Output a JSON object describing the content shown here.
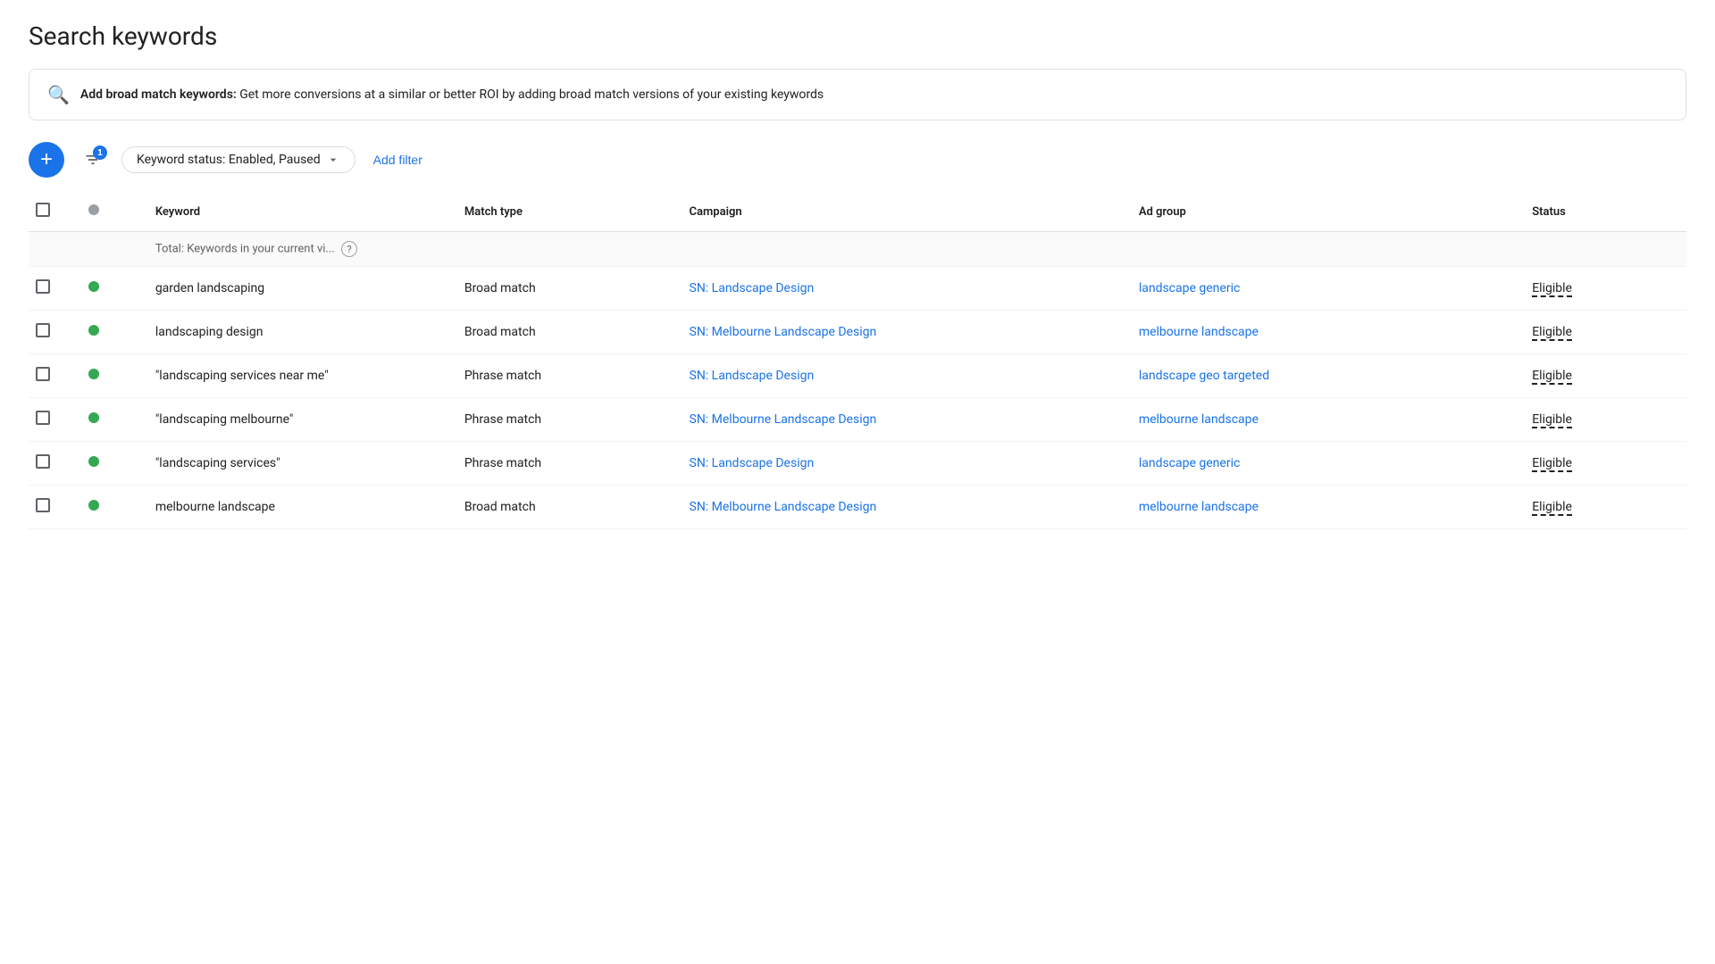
{
  "page": {
    "title": "Search keywords"
  },
  "banner": {
    "icon": "🔍",
    "label": "Add broad match keywords:",
    "description": "Get more conversions at a similar or better ROI by adding broad match versions of your existing keywords"
  },
  "toolbar": {
    "add_label": "+",
    "filter_badge": "1",
    "status_filter_label": "Keyword status: Enabled, Paused",
    "add_filter_label": "Add filter"
  },
  "table": {
    "columns": {
      "keyword": "Keyword",
      "match_type": "Match type",
      "campaign": "Campaign",
      "ad_group": "Ad group",
      "status": "Status"
    },
    "total_row": {
      "label": "Total: Keywords in your current vi..."
    },
    "rows": [
      {
        "id": 1,
        "status_dot": "green",
        "keyword": "garden landscaping",
        "match_type": "Broad match",
        "campaign": "SN: Landscape Design",
        "ad_group": "landscape generic",
        "status": "Eligible"
      },
      {
        "id": 2,
        "status_dot": "green",
        "keyword": "landscaping design",
        "match_type": "Broad match",
        "campaign": "SN: Melbourne Landscape Design",
        "ad_group": "melbourne landscape",
        "status": "Eligible"
      },
      {
        "id": 3,
        "status_dot": "green",
        "keyword": "\"landscaping services near me\"",
        "match_type": "Phrase match",
        "campaign": "SN: Landscape Design",
        "ad_group": "landscape geo targeted",
        "status": "Eligible"
      },
      {
        "id": 4,
        "status_dot": "green",
        "keyword": "\"landscaping melbourne\"",
        "match_type": "Phrase match",
        "campaign": "SN: Melbourne Landscape Design",
        "ad_group": "melbourne landscape",
        "status": "Eligible"
      },
      {
        "id": 5,
        "status_dot": "green",
        "keyword": "\"landscaping services\"",
        "match_type": "Phrase match",
        "campaign": "SN: Landscape Design",
        "ad_group": "landscape generic",
        "status": "Eligible"
      },
      {
        "id": 6,
        "status_dot": "green",
        "keyword": "melbourne landscape",
        "match_type": "Broad match",
        "campaign": "SN: Melbourne Landscape Design",
        "ad_group": "melbourne landscape",
        "status": "Eligible"
      }
    ]
  }
}
